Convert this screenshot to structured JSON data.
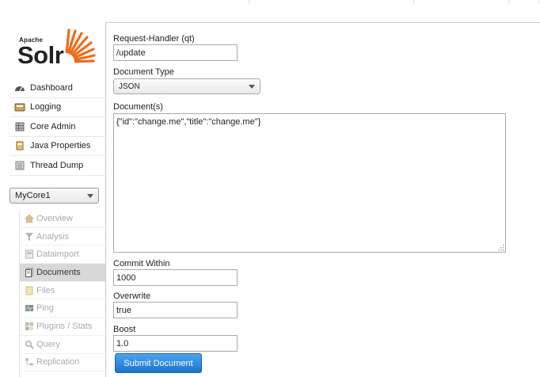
{
  "brand": {
    "apache": "Apache",
    "solr": "Solr",
    "accent": "#f06b1a"
  },
  "sidebar": {
    "main_items": [
      {
        "label": "Dashboard",
        "icon": "dashboard-icon"
      },
      {
        "label": "Logging",
        "icon": "logging-icon"
      },
      {
        "label": "Core Admin",
        "icon": "core-admin-icon"
      },
      {
        "label": "Java Properties",
        "icon": "java-icon"
      },
      {
        "label": "Thread Dump",
        "icon": "thread-dump-icon"
      }
    ],
    "core_selector": {
      "selected": "MyCore1"
    },
    "core_items": [
      {
        "label": "Overview",
        "icon": "home-icon"
      },
      {
        "label": "Analysis",
        "icon": "funnel-icon"
      },
      {
        "label": "Dataimport",
        "icon": "dataimport-icon"
      },
      {
        "label": "Documents",
        "icon": "documents-icon",
        "active": true
      },
      {
        "label": "Files",
        "icon": "folder-icon"
      },
      {
        "label": "Ping",
        "icon": "ping-icon"
      },
      {
        "label": "Plugins / Stats",
        "icon": "plugins-icon"
      },
      {
        "label": "Query",
        "icon": "magnifier-icon"
      },
      {
        "label": "Replication",
        "icon": "replication-icon"
      }
    ]
  },
  "form": {
    "request_handler": {
      "label": "Request-Handler (qt)",
      "value": "/update"
    },
    "document_type": {
      "label": "Document Type",
      "value": "JSON"
    },
    "documents": {
      "label": "Document(s)",
      "value": "{\"id\":\"change.me\",\"title\":\"change.me\"}"
    },
    "commit_within": {
      "label": "Commit Within",
      "value": "1000"
    },
    "overwrite": {
      "label": "Overwrite",
      "value": "true"
    },
    "boost": {
      "label": "Boost",
      "value": "1.0"
    },
    "submit_label": "Submit Document"
  },
  "colors": {
    "submit_top": "#4aa3ee",
    "submit_bottom": "#1b74cf",
    "active_nav": "#d8d8d8"
  }
}
